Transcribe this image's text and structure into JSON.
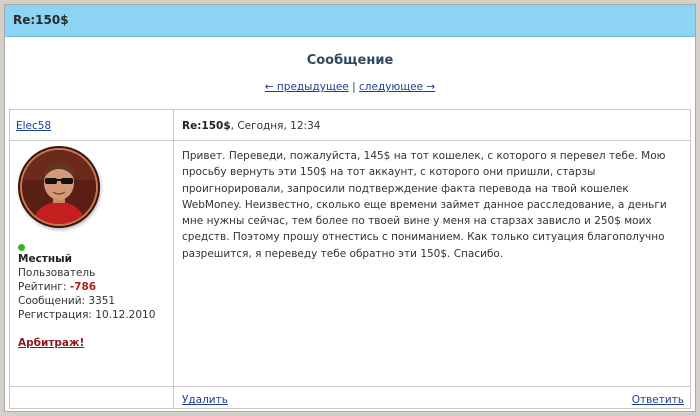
{
  "title": "Re:150$",
  "heading": "Сообщение",
  "nav": {
    "prev": "← предыдущее",
    "separator": "|",
    "next": "следующее →"
  },
  "post": {
    "author": "Elec58",
    "subject": "Re:150$",
    "date_suffix": ", Сегодня, 12:34",
    "user": {
      "rank": "Местный",
      "group": "Пользователь",
      "rating_label": "Рейтинг:",
      "rating_value": "-786",
      "messages": "Сообщений: 3351",
      "registered": "Регистрация: 10.12.2010",
      "arbitration": "Арбитраж!",
      "online_color": "#3fae2a"
    },
    "body": "Привет. Переведи, пожалуйста, 145$ на тот кошелек, с которого я перевел тебе. Мою просьбу вернуть эти 150$ на тот аккаунт, с которого они пришли, старзы проигнорировали, запросили подтверждение факта перевода на твой кошелек WebMoney. Неизвестно, сколько еще времени займет данное расследование, а деньги мне нужны сейчас, тем более по твоей вине у меня на старзах зависло и 250$ моих средств. Поэтому прошу отнестись с пониманием. Как только ситуация благополучно разрешится, я переведу тебе обратно эти 150$. Спасибо.",
    "delete": "Удалить",
    "reply": "Ответить"
  },
  "colors": {
    "titlebar": "#8dd3f4",
    "link": "#1a3f8e",
    "rating": "#b01e1e",
    "arbitration": "#8b1a1a"
  }
}
